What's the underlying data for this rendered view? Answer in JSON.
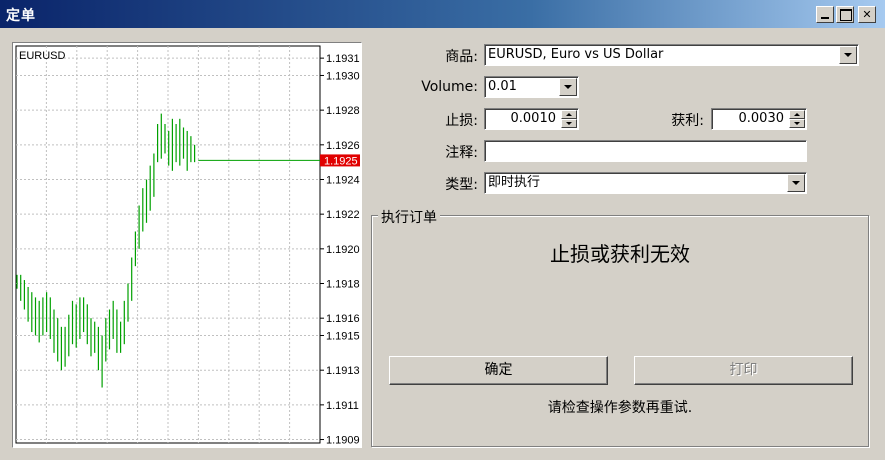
{
  "window": {
    "title": "定单"
  },
  "form": {
    "symbol_label": "商品:",
    "symbol_value": "EURUSD, Euro vs US Dollar",
    "volume_label": "Volume:",
    "volume_value": "0.01",
    "stoploss_label": "止损:",
    "stoploss_value": "0.0010",
    "takeprofit_label": "获利:",
    "takeprofit_value": "0.0030",
    "comment_label": "注释:",
    "comment_value": "",
    "type_label": "类型:",
    "type_value": "即时执行"
  },
  "execution": {
    "group_title": "执行订单",
    "message": "止损或获利无效",
    "ok_label": "确定",
    "print_label": "打印",
    "hint": "请检查操作参数再重试."
  },
  "chart_data": {
    "type": "line",
    "symbol": "EURUSD",
    "y_ticks": [
      "1.1931",
      "1.1930",
      "1.1928",
      "1.1926",
      "1.1924",
      "1.1922",
      "1.1920",
      "1.1918",
      "1.1916",
      "1.1915",
      "1.1913",
      "1.1911",
      "1.1909"
    ],
    "ylim": [
      1.19088,
      1.19317
    ],
    "current_price": "1.1925",
    "current_value": 1.19251,
    "grid": true,
    "series_color": "#00a000",
    "current_color": "#e00000",
    "ticks": [
      {
        "lo": 1.19177,
        "hi": 1.19185
      },
      {
        "lo": 1.1917,
        "hi": 1.19185
      },
      {
        "lo": 1.19165,
        "hi": 1.19182
      },
      {
        "lo": 1.19158,
        "hi": 1.19178
      },
      {
        "lo": 1.19152,
        "hi": 1.19175
      },
      {
        "lo": 1.1915,
        "hi": 1.19172
      },
      {
        "lo": 1.19146,
        "hi": 1.1917
      },
      {
        "lo": 1.1915,
        "hi": 1.19172
      },
      {
        "lo": 1.19152,
        "hi": 1.19175
      },
      {
        "lo": 1.19148,
        "hi": 1.19172
      },
      {
        "lo": 1.1914,
        "hi": 1.19165
      },
      {
        "lo": 1.19135,
        "hi": 1.1916
      },
      {
        "lo": 1.1913,
        "hi": 1.19155
      },
      {
        "lo": 1.19132,
        "hi": 1.19155
      },
      {
        "lo": 1.19138,
        "hi": 1.19162
      },
      {
        "lo": 1.19145,
        "hi": 1.1917
      },
      {
        "lo": 1.19143,
        "hi": 1.19168
      },
      {
        "lo": 1.19148,
        "hi": 1.19172
      },
      {
        "lo": 1.19152,
        "hi": 1.19172
      },
      {
        "lo": 1.19145,
        "hi": 1.19168
      },
      {
        "lo": 1.19138,
        "hi": 1.1916
      },
      {
        "lo": 1.1914,
        "hi": 1.19158
      },
      {
        "lo": 1.1913,
        "hi": 1.19155
      },
      {
        "lo": 1.1912,
        "hi": 1.1915
      },
      {
        "lo": 1.19135,
        "hi": 1.1916
      },
      {
        "lo": 1.19142,
        "hi": 1.19165
      },
      {
        "lo": 1.19148,
        "hi": 1.1917
      },
      {
        "lo": 1.1914,
        "hi": 1.19165
      },
      {
        "lo": 1.1914,
        "hi": 1.19158
      },
      {
        "lo": 1.19145,
        "hi": 1.1917
      },
      {
        "lo": 1.19158,
        "hi": 1.1918
      },
      {
        "lo": 1.1917,
        "hi": 1.19195
      },
      {
        "lo": 1.1919,
        "hi": 1.1921
      },
      {
        "lo": 1.192,
        "hi": 1.19225
      },
      {
        "lo": 1.1921,
        "hi": 1.19235
      },
      {
        "lo": 1.19215,
        "hi": 1.1924
      },
      {
        "lo": 1.19222,
        "hi": 1.19248
      },
      {
        "lo": 1.1923,
        "hi": 1.19255
      },
      {
        "lo": 1.1925,
        "hi": 1.19272
      },
      {
        "lo": 1.19252,
        "hi": 1.19278
      },
      {
        "lo": 1.19255,
        "hi": 1.19272
      },
      {
        "lo": 1.19248,
        "hi": 1.19268
      },
      {
        "lo": 1.19245,
        "hi": 1.19275
      },
      {
        "lo": 1.1925,
        "hi": 1.19272
      },
      {
        "lo": 1.19248,
        "hi": 1.19275
      },
      {
        "lo": 1.19252,
        "hi": 1.1927
      },
      {
        "lo": 1.19245,
        "hi": 1.19268
      },
      {
        "lo": 1.1925,
        "hi": 1.19265
      },
      {
        "lo": 1.1925,
        "hi": 1.1926
      },
      {
        "lo": 1.19251,
        "hi": 1.19251
      }
    ]
  }
}
